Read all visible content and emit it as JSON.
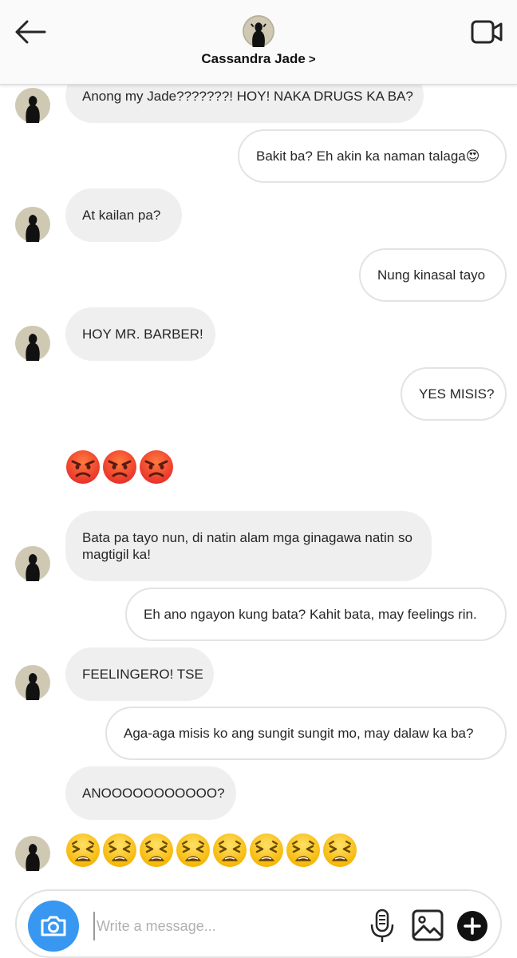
{
  "header": {
    "contact_name": "Cassandra Jade",
    "chevron": ">"
  },
  "messages": [
    {
      "side": "in",
      "text": "Anong my Jade???????! HOY! NAKA DRUGS KA BA?"
    },
    {
      "side": "out",
      "text": "Bakit ba? Eh akin ka naman talaga😍"
    },
    {
      "side": "in",
      "text": "At kailan pa?"
    },
    {
      "side": "out",
      "text": "Nung kinasal tayo"
    },
    {
      "side": "in",
      "text": "HOY MR. BARBER!"
    },
    {
      "side": "out",
      "text": "YES MISIS?"
    },
    {
      "side": "in",
      "emoji": "angry-face",
      "count": 3
    },
    {
      "side": "in",
      "text": "Bata pa tayo nun, di natin alam mga ginagawa natin so magtigil ka!"
    },
    {
      "side": "out",
      "text": "Eh ano ngayon kung bata? Kahit bata, may feelings rin."
    },
    {
      "side": "in",
      "text": "FEELINGERO! TSE"
    },
    {
      "side": "out",
      "text": "Aga-aga misis ko ang sungit sungit mo, may dalaw ka ba?"
    },
    {
      "side": "in",
      "text": "ANOOOOOOOOOOO?"
    },
    {
      "side": "in",
      "emoji": "tired-face",
      "count": 8
    }
  ],
  "composer": {
    "placeholder": "Write a message..."
  },
  "icons": {
    "back": "back-arrow-icon",
    "video": "video-call-icon",
    "camera": "camera-icon",
    "mic": "microphone-icon",
    "gallery": "gallery-icon",
    "plus": "plus-icon"
  },
  "colors": {
    "accent": "#3897f0",
    "incoming_bubble": "#efefef",
    "outgoing_border": "#e3e3e3"
  }
}
